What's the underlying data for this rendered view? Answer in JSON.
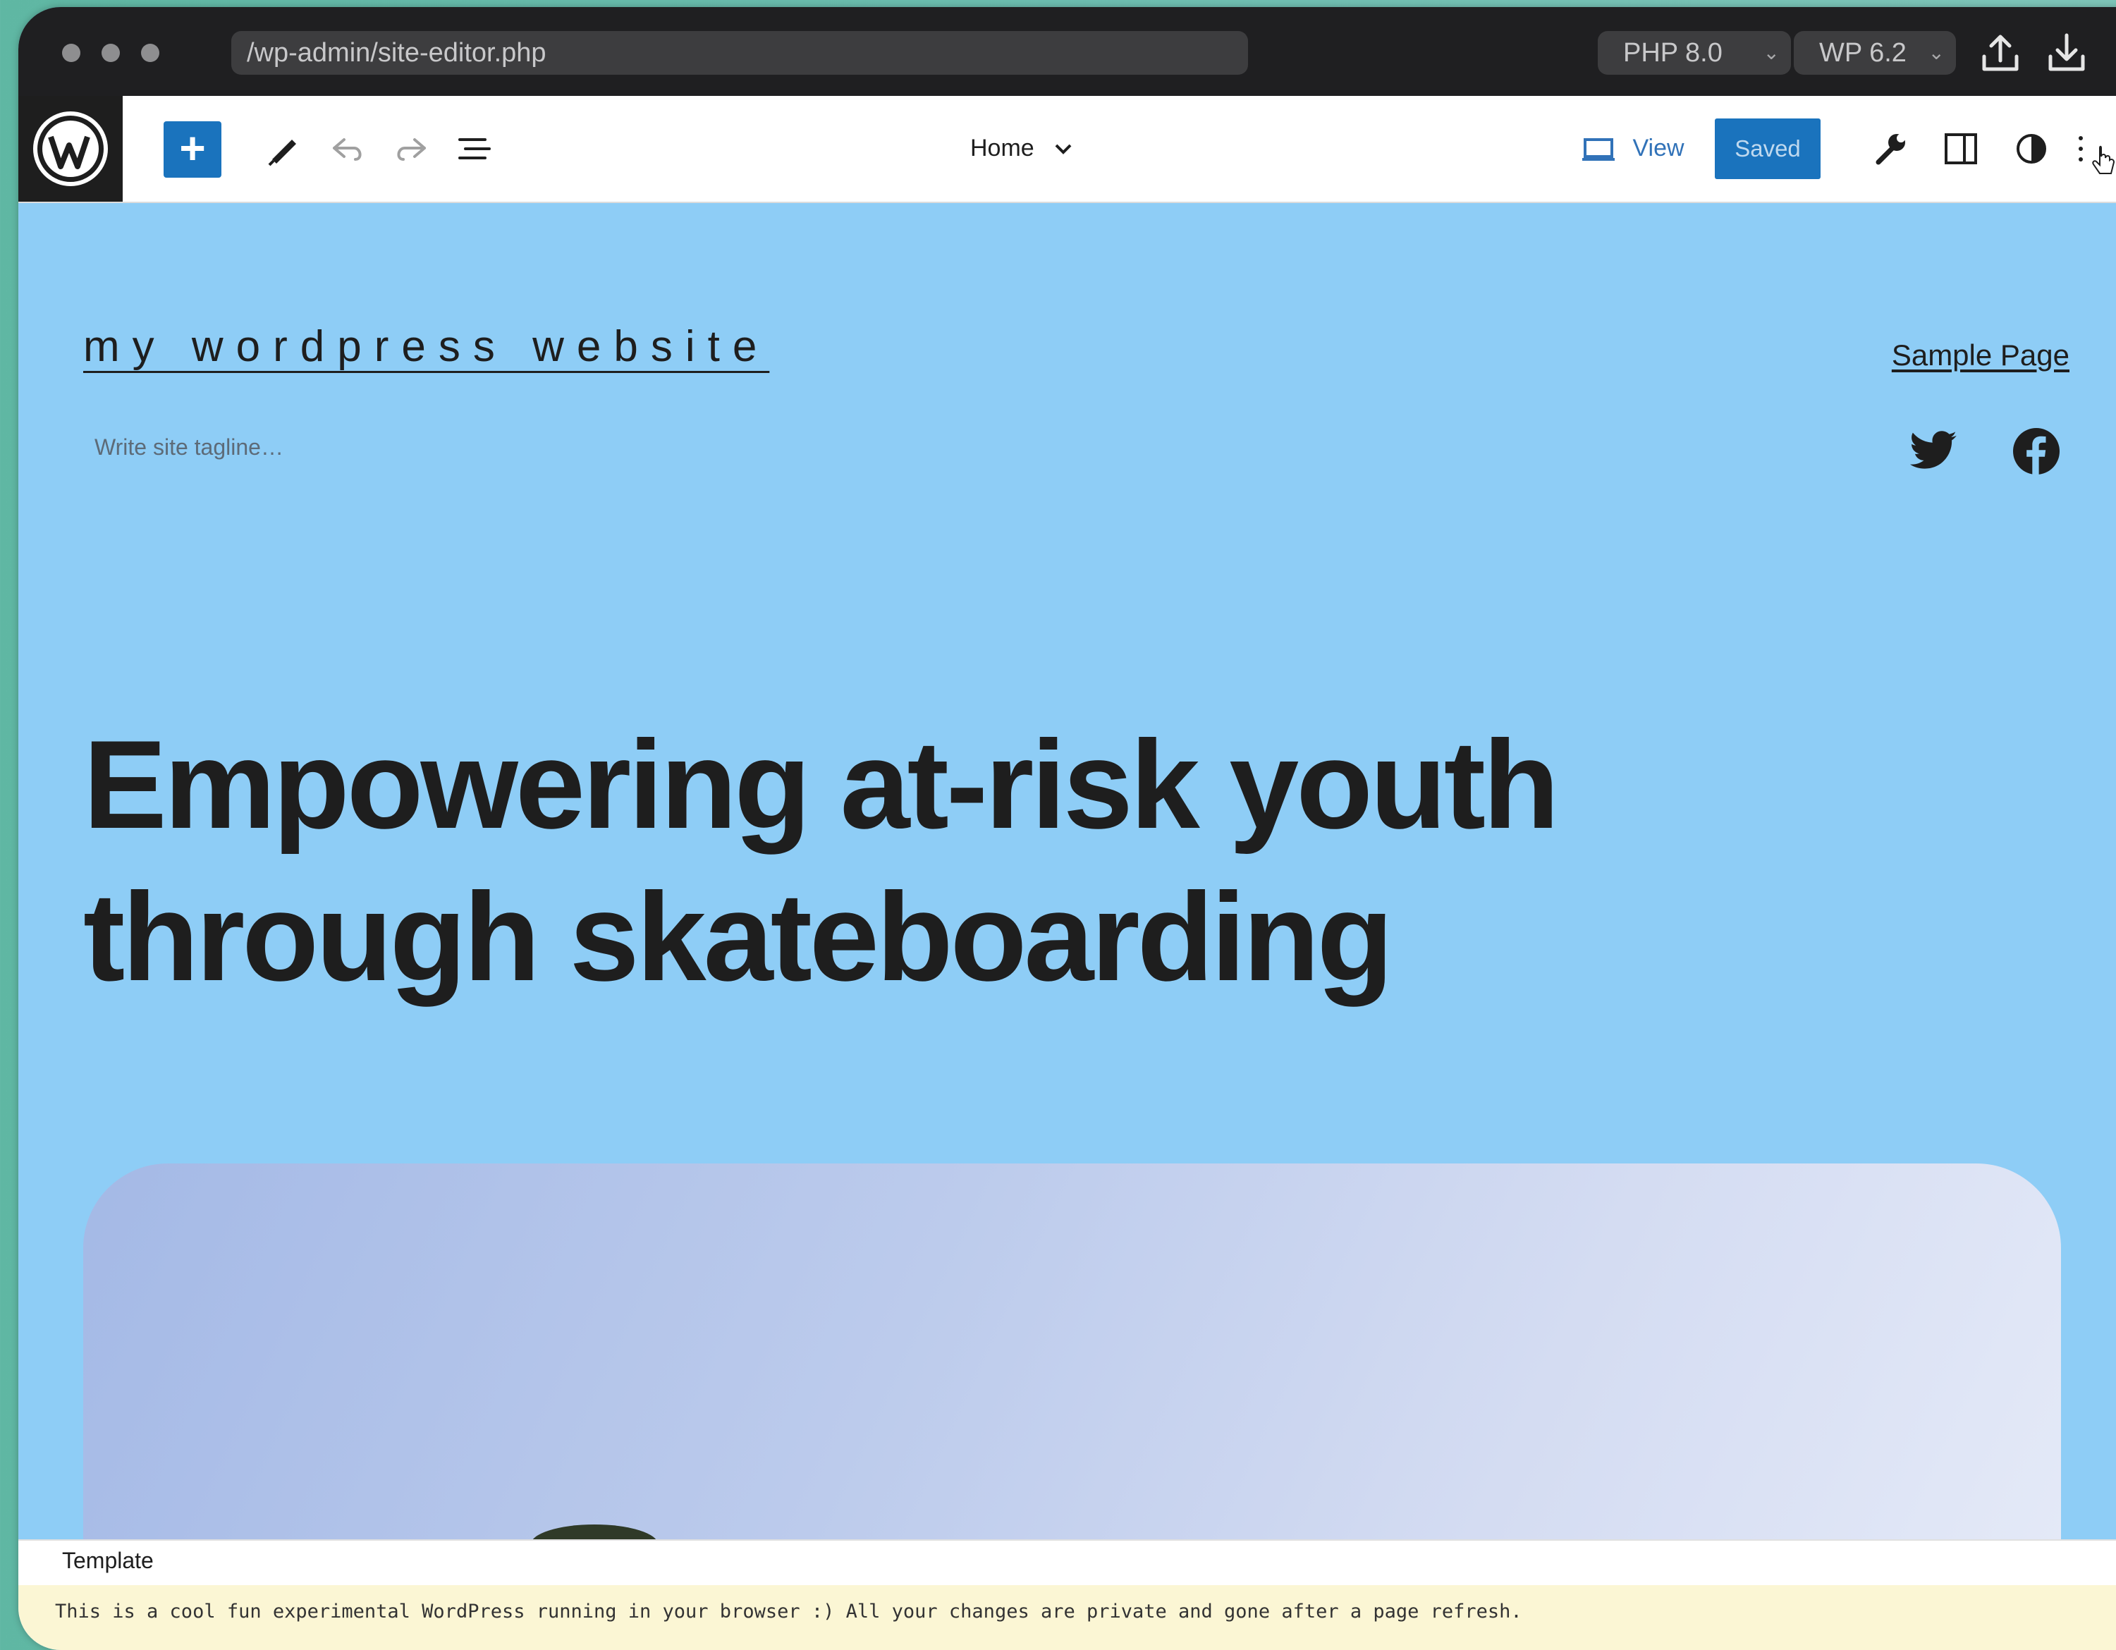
{
  "browser": {
    "url": "/wp-admin/site-editor.php",
    "php_select": "PHP 8.0",
    "wp_select": "WP 6.2",
    "icons": [
      "upload-icon",
      "download-icon"
    ]
  },
  "toolbar": {
    "add_label": "+",
    "document_title": "Home",
    "view_label": "View",
    "saved_label": "Saved",
    "icons": [
      "wordpress-logo-icon",
      "pencil-icon",
      "undo-icon",
      "redo-icon",
      "list-view-icon",
      "monitor-icon",
      "wrench-icon",
      "sidebar-icon",
      "half-circle-icon",
      "more-options-icon"
    ]
  },
  "site": {
    "title": "my wordpress website",
    "tagline": "Write site tagline…",
    "nav_link": "Sample Page",
    "social": [
      "twitter-icon",
      "facebook-icon"
    ]
  },
  "hero": {
    "heading_line1": "Empowering at-risk youth",
    "heading_line2": "through skateboarding"
  },
  "footer": {
    "breadcrumb": "Template",
    "notice": "This is a cool fun experimental WordPress running in your browser :) All your changes are private and gone after a page refresh."
  },
  "colors": {
    "canvas_bg": "#8ecdf6",
    "accent": "#1a73bd",
    "notice_bg": "#fbf6d4"
  }
}
